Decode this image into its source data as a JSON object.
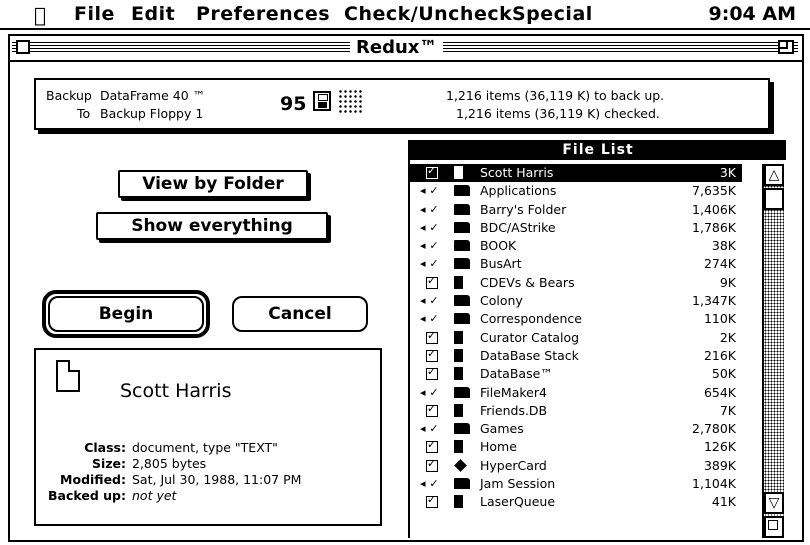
{
  "menubar": {
    "apple_icon": "apple-icon",
    "items": [
      "File",
      "Edit",
      "Preferences",
      "Check/Uncheck",
      "Special"
    ],
    "clock": "9:04 AM"
  },
  "window": {
    "title": "Redux™"
  },
  "status": {
    "backup_label": "Backup",
    "backup_value": "DataFrame 40 ™",
    "to_label": "To",
    "to_value": "Backup Floppy 1",
    "disk_count": "95",
    "items_to_backup": "1,216 items  (36,119 K) to back up.",
    "items_checked": "1,216 items  (36,119 K) checked."
  },
  "buttons": {
    "view_by_folder": "View by Folder",
    "show_everything": "Show everything",
    "begin": "Begin",
    "cancel": "Cancel"
  },
  "info": {
    "file_name": "Scott Harris",
    "class_label": "Class:",
    "class_value": "document, type \"TEXT\"",
    "size_label": "Size:",
    "size_value": "2,805 bytes",
    "modified_label": "Modified:",
    "modified_value": "Sat, Jul 30, 1988, 11:07 PM",
    "backed_label": "Backed up:",
    "backed_value": "not yet"
  },
  "file_list": {
    "title": "File List",
    "rows": [
      {
        "name": "Scott Harris",
        "size": "3K",
        "mark": "check",
        "kind": "doc",
        "selected": true
      },
      {
        "name": "Applications",
        "size": "7,635K",
        "mark": "tri",
        "kind": "folder"
      },
      {
        "name": "Barry's Folder",
        "size": "1,406K",
        "mark": "tri",
        "kind": "folder"
      },
      {
        "name": "BDC/AStrike",
        "size": "1,786K",
        "mark": "tri",
        "kind": "folder"
      },
      {
        "name": "BOOK",
        "size": "38K",
        "mark": "tri",
        "kind": "folder"
      },
      {
        "name": "BusArt",
        "size": "274K",
        "mark": "tri",
        "kind": "folder"
      },
      {
        "name": "CDEVs & Bears",
        "size": "9K",
        "mark": "check",
        "kind": "doc"
      },
      {
        "name": "Colony",
        "size": "1,347K",
        "mark": "tri",
        "kind": "folder"
      },
      {
        "name": "Correspondence",
        "size": "110K",
        "mark": "tri",
        "kind": "folder"
      },
      {
        "name": "Curator Catalog",
        "size": "2K",
        "mark": "check",
        "kind": "doc"
      },
      {
        "name": "DataBase Stack",
        "size": "216K",
        "mark": "check",
        "kind": "doc"
      },
      {
        "name": "DataBase™",
        "size": "50K",
        "mark": "check",
        "kind": "doc"
      },
      {
        "name": "FileMaker4",
        "size": "654K",
        "mark": "tri",
        "kind": "folder"
      },
      {
        "name": "Friends.DB",
        "size": "7K",
        "mark": "check",
        "kind": "doc"
      },
      {
        "name": "Games",
        "size": "2,780K",
        "mark": "tri",
        "kind": "folder"
      },
      {
        "name": "Home",
        "size": "126K",
        "mark": "check",
        "kind": "doc"
      },
      {
        "name": "HyperCard",
        "size": "389K",
        "mark": "check",
        "kind": "stack"
      },
      {
        "name": "Jam Session",
        "size": "1,104K",
        "mark": "tri",
        "kind": "folder"
      },
      {
        "name": "LaserQueue",
        "size": "41K",
        "mark": "check",
        "kind": "doc"
      }
    ]
  }
}
